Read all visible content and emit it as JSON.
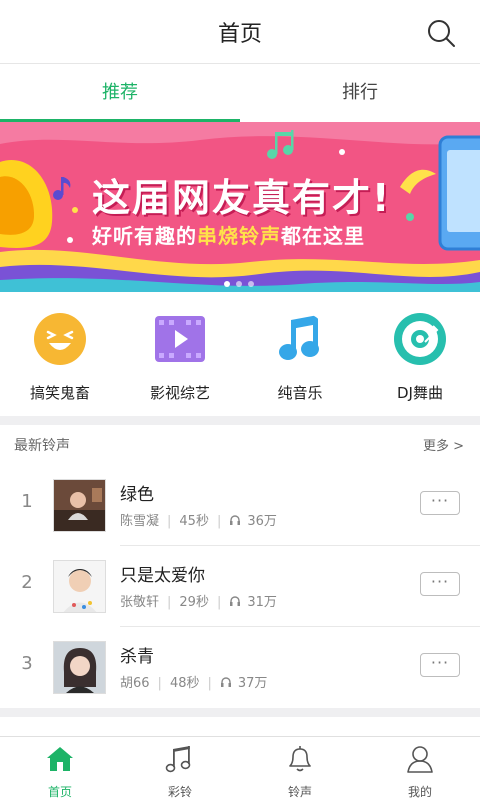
{
  "header": {
    "title": "首页"
  },
  "tabs": [
    {
      "label": "推荐"
    },
    {
      "label": "排行"
    }
  ],
  "banner": {
    "headline": "这届网友真有才!",
    "sub_prefix": "好听有趣的",
    "sub_highlight": "串烧铃声",
    "sub_suffix": "都在这里"
  },
  "categories": [
    {
      "label": "搞笑鬼畜",
      "icon": "laugh-face-icon",
      "color": "#f7b733"
    },
    {
      "label": "影视综艺",
      "icon": "video-icon",
      "color": "#a073e8"
    },
    {
      "label": "纯音乐",
      "icon": "music-note-icon",
      "color": "#35a7e8"
    },
    {
      "label": "DJ舞曲",
      "icon": "disc-icon",
      "color": "#27bfae"
    }
  ],
  "section": {
    "title": "最新铃声",
    "more": "更多 >"
  },
  "songs": [
    {
      "rank": "1",
      "name": "绿色",
      "artist": "陈雪凝",
      "duration": "45秒",
      "plays": "36万"
    },
    {
      "rank": "2",
      "name": "只是太爱你",
      "artist": "张敬轩",
      "duration": "29秒",
      "plays": "31万"
    },
    {
      "rank": "3",
      "name": "杀青",
      "artist": "胡66",
      "duration": "48秒",
      "plays": "37万"
    }
  ],
  "row_options_label": "···",
  "bottom_nav": [
    {
      "label": "首页",
      "icon": "home-icon"
    },
    {
      "label": "彩铃",
      "icon": "music-notes-icon"
    },
    {
      "label": "铃声",
      "icon": "bell-icon"
    },
    {
      "label": "我的",
      "icon": "person-icon"
    }
  ],
  "colors": {
    "accent": "#1db367",
    "banner_bg": "#f25584"
  }
}
